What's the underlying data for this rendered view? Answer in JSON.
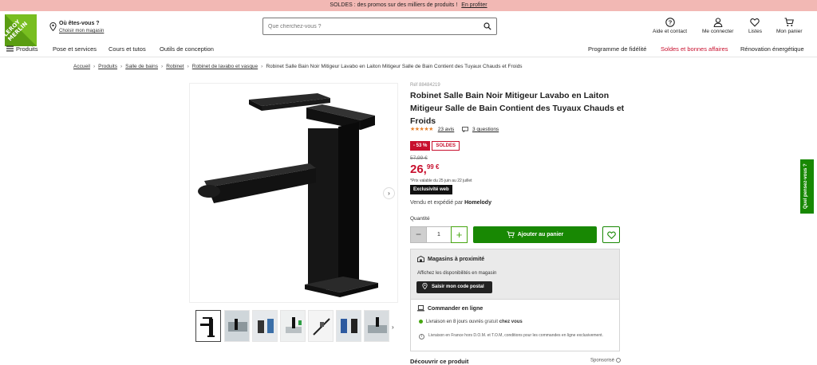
{
  "promo": {
    "text": "SOLDES : des promos sur des milliers de produits !",
    "link": "En profiter"
  },
  "header": {
    "logo_text": "LEROY MERLIN",
    "location_title": "Où êtes-vous ?",
    "location_link": "Choisir mon magasin",
    "search_placeholder": "Que cherchez-vous ?",
    "help": "Aide et contact",
    "account": "Me connecter",
    "lists": "Listes",
    "cart": "Mon panier"
  },
  "nav": {
    "products": "Produits",
    "items": [
      "Pose et services",
      "Cours et tutos",
      "Outils de conception"
    ],
    "right": [
      "Programme de fidélité",
      "Soldes et bonnes affaires",
      "Rénovation énergétique"
    ]
  },
  "breadcrumb": [
    "Accueil",
    "Produits",
    "Salle de bains",
    "Robinet",
    "Robinet de lavabo et vasque",
    "Robinet Salle Bain Noir Mitigeur Lavabo en Laiton Mitigeur Salle de Bain Contient des Tuyaux Chauds et Froids"
  ],
  "product": {
    "ref": "Réf 88484219",
    "title": "Robinet Salle Bain Noir Mitigeur Lavabo en Laiton Mitigeur Salle de Bain Contient des Tuyaux Chauds et Froids",
    "stars": "★★★★★",
    "rating_value": 4.5,
    "reviews": "23 avis",
    "questions": "3 questions",
    "discount": "- 53 %",
    "sale_badge": "SOLDES",
    "old_price": "57,99 €",
    "price_int": "26,",
    "price_dec": "99 €",
    "price_validity": "*Prix valable du 25 juin au 22 juillet",
    "exclusive": "Exclusivité web",
    "seller_prefix": "Vendu et expédié par",
    "seller": "Homelody",
    "qty_label": "Quantité",
    "qty_value": "1",
    "add_to_cart": "Ajouter au panier"
  },
  "stores": {
    "title": "Magasins à proximité",
    "text": "Affichez les disponibilités en magasin",
    "button": "Saisir mon code postal"
  },
  "online": {
    "title": "Commander en ligne",
    "delivery_prefix": "Livraison en 8 jours ouvrés",
    "delivery_free": "gratuit",
    "delivery_suffix": "chez vous",
    "note": "Livraison en France hors D.O.M. et T.O.M, conditions pour les commandes en ligne exclusivement."
  },
  "discover": "Découvrir ce produit",
  "sponsored": "Sponsorisé",
  "feedback": "Quel pensez-vous ?",
  "colors": {
    "brand_green": "#78be20",
    "cta_green": "#188803",
    "sale_red": "#c8102e",
    "promo_pink": "#f2b8b4"
  }
}
